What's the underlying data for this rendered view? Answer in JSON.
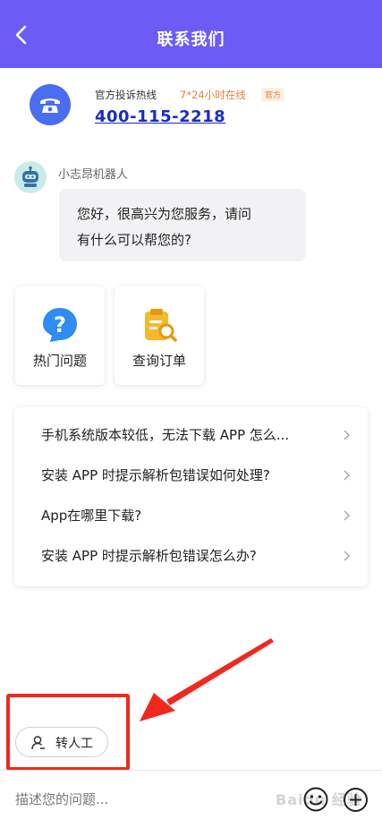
{
  "header": {
    "title": "联系我们"
  },
  "hotline": {
    "label": "官方投诉热线",
    "hours": "7*24小时在线",
    "badge": "官方",
    "number": "400-115-2218"
  },
  "bot": {
    "name": "小志昂机器人",
    "message_line1": "您好，很高兴为您服务，请问",
    "message_line2": "有什么可以帮您的?"
  },
  "quick_cards": [
    {
      "label": "热门问题",
      "icon": "question-icon"
    },
    {
      "label": "查询订单",
      "icon": "order-search-icon"
    }
  ],
  "faq": [
    {
      "text": "手机系统版本较低，无法下载 APP 怎么..."
    },
    {
      "text": "安装 APP 时提示解析包错误如何处理?"
    },
    {
      "text": "App在哪里下载?"
    },
    {
      "text": "安装 APP 时提示解析包错误怎么办?"
    }
  ],
  "transfer": {
    "label": "转人工"
  },
  "input": {
    "placeholder": "描述您的问题..."
  },
  "watermark": "Baidu 经验",
  "colors": {
    "header": "#6b5cf5",
    "hotline_icon": "#4a6ef0",
    "hotline_number": "#1a2bc4",
    "accent_orange": "#e8813a",
    "annotation_red": "#f0281e"
  }
}
